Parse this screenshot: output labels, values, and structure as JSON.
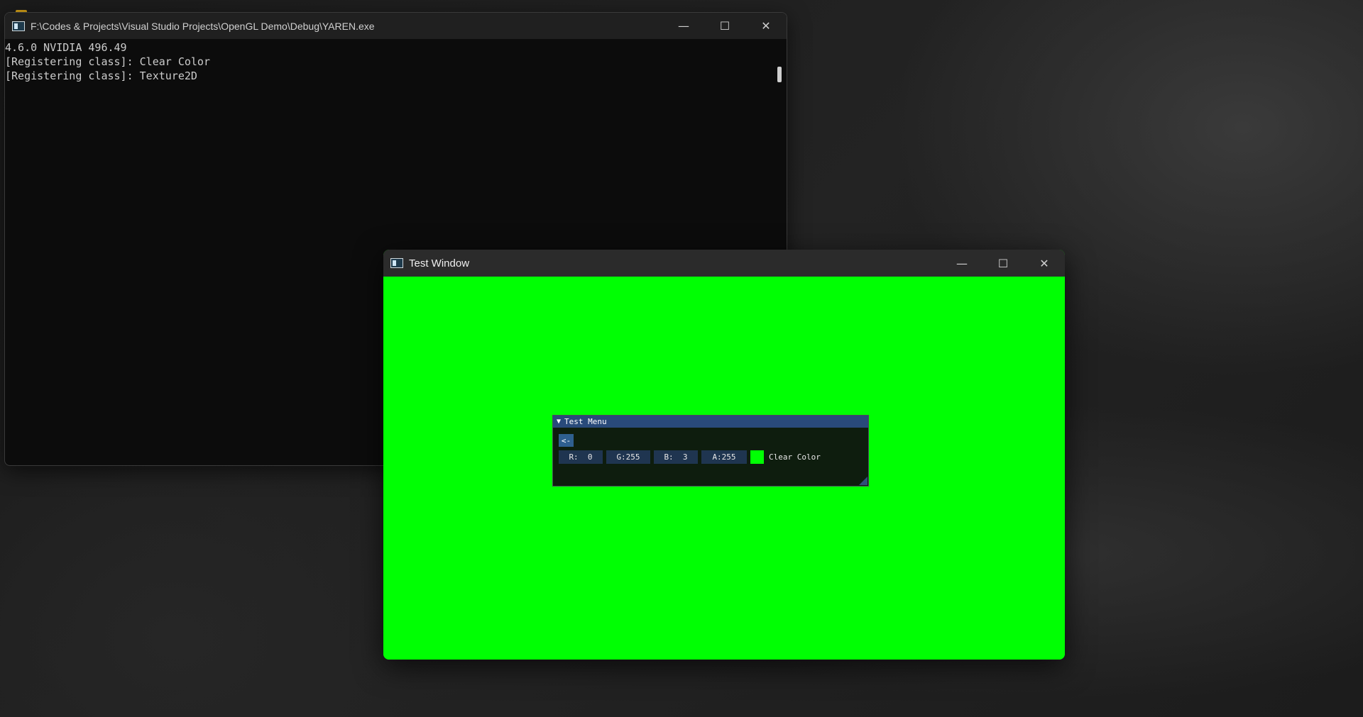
{
  "console_window": {
    "title": "F:\\Codes & Projects\\Visual Studio Projects\\OpenGL Demo\\Debug\\YAREN.exe",
    "icon": "console-app-icon",
    "lines": [
      "4.6.0 NVIDIA 496.49",
      "[Registering class]: Clear Color",
      "[Registering class]: Texture2D"
    ],
    "caption_buttons": {
      "minimize": "—",
      "maximize": "☐",
      "close": "✕"
    }
  },
  "test_window": {
    "title": "Test Window",
    "icon": "window-app-icon",
    "clear_color_hex": "#00ff03",
    "caption_buttons": {
      "minimize": "—",
      "maximize": "☐",
      "close": "✕"
    }
  },
  "imgui_panel": {
    "title": "Test Menu",
    "collapse_arrow": "▼",
    "back_button_label": "<-",
    "fields": {
      "r": "R:  0",
      "g": "G:255",
      "b": "B:  3",
      "a": "A:255"
    },
    "color_label": "Clear Color",
    "swatch_color": "#00ff03"
  }
}
